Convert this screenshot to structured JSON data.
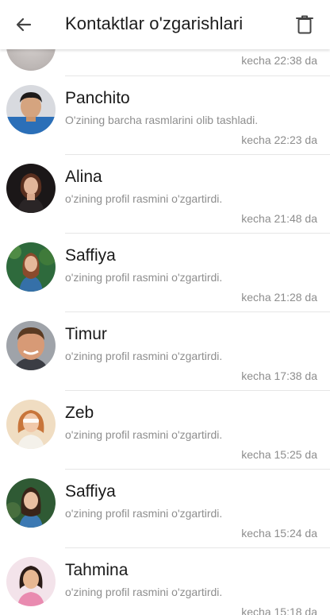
{
  "header": {
    "title": "Kontaktlar o'zgarishlari",
    "back_icon": "arrow-left-icon",
    "delete_icon": "trash-icon"
  },
  "partial_item": {
    "time": "kecha 22:38 da"
  },
  "items": [
    {
      "name": "Panchito",
      "status": "O'zining barcha rasmlarini olib tashladi.",
      "time": "kecha 22:23 da"
    },
    {
      "name": "Alina",
      "status": "o'zining profil rasmini o'zgartirdi.",
      "time": "kecha 21:48 da"
    },
    {
      "name": "Saffiya",
      "status": "o'zining profil rasmini o'zgartirdi.",
      "time": "kecha 21:28 da"
    },
    {
      "name": "Timur",
      "status": "o'zining profil rasmini o'zgartirdi.",
      "time": "kecha 17:38 da"
    },
    {
      "name": "Zeb",
      "status": "o'zining profil rasmini o'zgartirdi.",
      "time": "kecha 15:25 da"
    },
    {
      "name": "Saffiya",
      "status": "o'zining profil rasmini o'zgartirdi.",
      "time": "kecha 15:24 da"
    },
    {
      "name": "Tahmina",
      "status": "o'zining profil rasmini o'zgartirdi.",
      "time": "kecha 15:18 da"
    }
  ],
  "colors": {
    "primary_text": "#1a1a1a",
    "secondary_text": "#8e8e8e",
    "divider": "#e6e6e6",
    "background": "#ffffff"
  }
}
